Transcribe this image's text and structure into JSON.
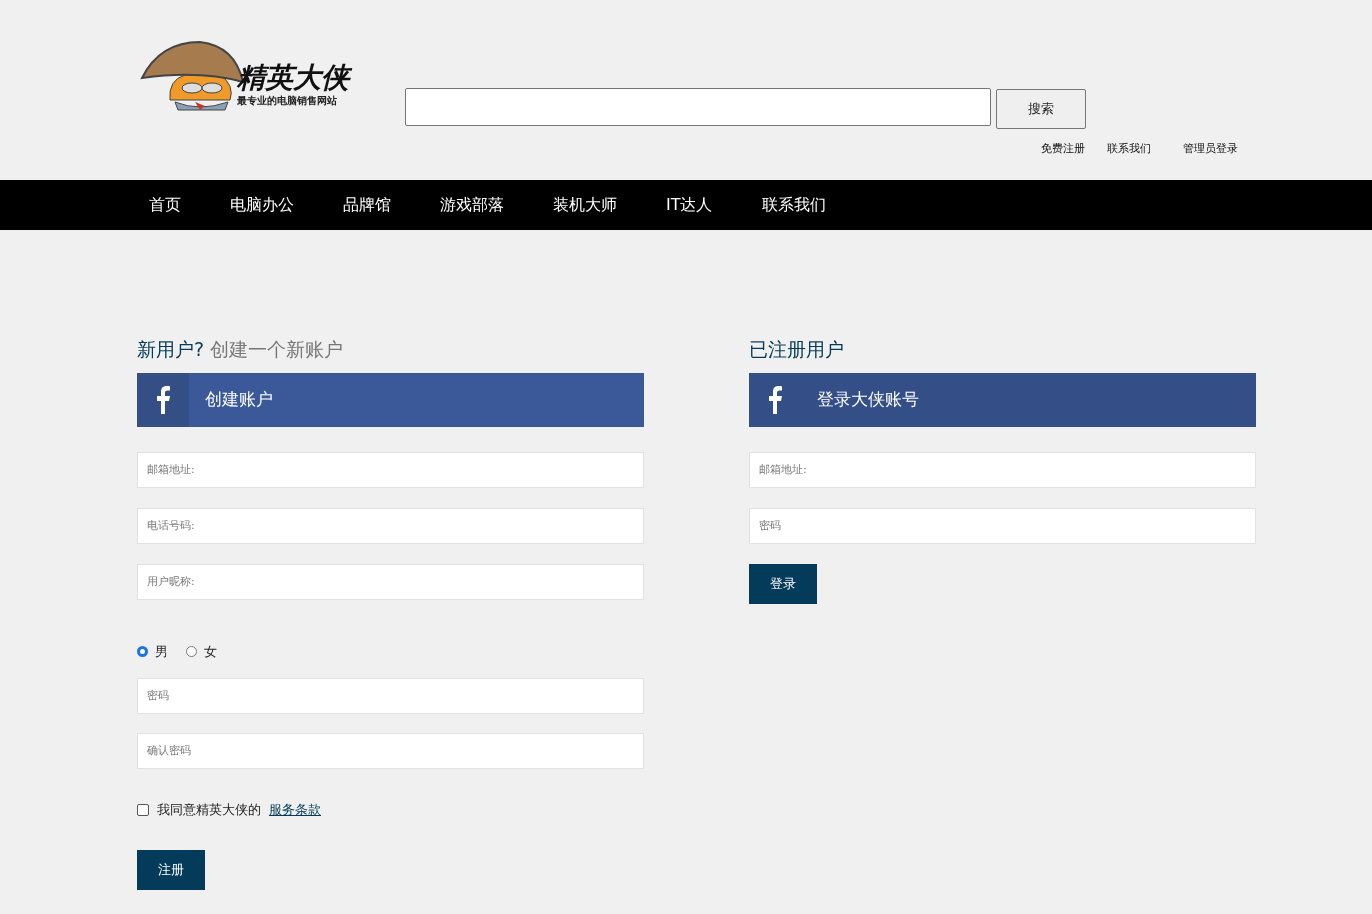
{
  "logo": {
    "title": "精英大侠",
    "tagline": "最专业的电脑销售网站"
  },
  "search": {
    "button": "搜索"
  },
  "top_links": [
    "免费注册",
    "联系我们",
    "管理员登录"
  ],
  "nav": [
    "首页",
    "电脑办公",
    "品牌馆",
    "游戏部落",
    "装机大师",
    "IT达人",
    "联系我们"
  ],
  "register": {
    "heading": "新用户?",
    "subheading": "创建一个新账户",
    "banner": "创建账户",
    "fields": [
      {
        "placeholder": "邮箱地址:"
      },
      {
        "placeholder": "电话号码:"
      },
      {
        "placeholder": "用户昵称:"
      }
    ],
    "gender": [
      {
        "label": "男",
        "selected": true
      },
      {
        "label": "女",
        "selected": false
      }
    ],
    "password_fields": [
      {
        "placeholder": "密码"
      },
      {
        "placeholder": "确认密码"
      }
    ],
    "agree": {
      "text": "我同意精英大侠的",
      "link": "服务条款",
      "checked": false
    },
    "button": "注册"
  },
  "login": {
    "heading": "已注册用户",
    "banner": "登录大侠账号",
    "fields": [
      {
        "placeholder": "邮箱地址:"
      },
      {
        "placeholder": "密码"
      }
    ],
    "button": "登录"
  }
}
